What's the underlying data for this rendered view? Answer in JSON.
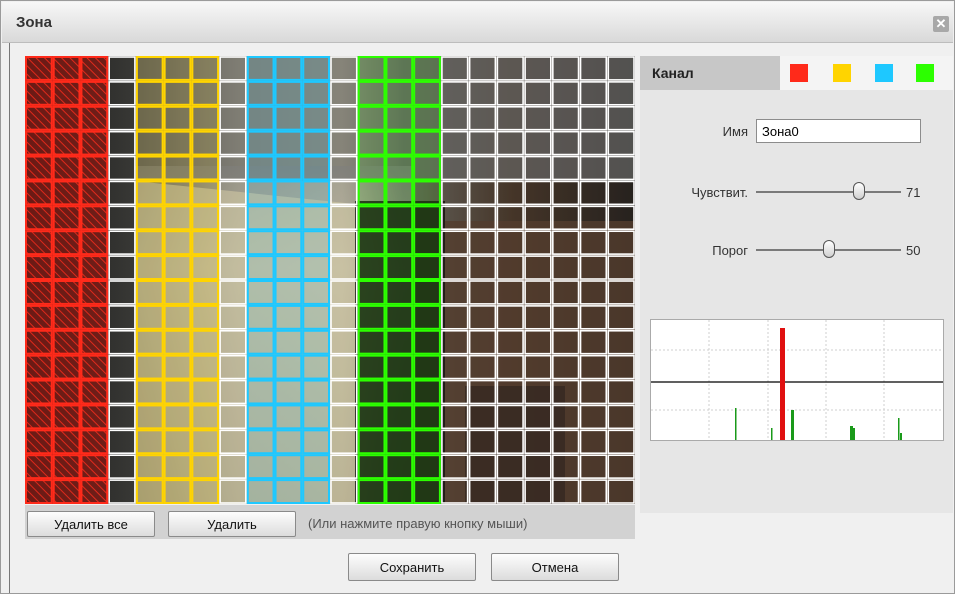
{
  "window": {
    "title": "Зона",
    "close_glyph": "✕"
  },
  "grid": {
    "cols": 22,
    "rows": 18,
    "zones": [
      {
        "color": "#ff2a1a",
        "col_start": 0,
        "col_end": 2,
        "style": "hatched"
      },
      {
        "color": "#ffd400",
        "col_start": 4,
        "col_end": 6,
        "style": "outlined"
      },
      {
        "color": "#1ec8ff",
        "col_start": 8,
        "col_end": 10,
        "style": "outlined"
      },
      {
        "color": "#2cff00",
        "col_start": 12,
        "col_end": 14,
        "style": "outlined"
      }
    ]
  },
  "buttons": {
    "delete_all": "Удалить все",
    "delete": "Удалить",
    "hint": "(Или нажмите правую кнопку мыши)",
    "save": "Сохранить",
    "cancel": "Отмена"
  },
  "panel": {
    "channel_label": "Канал",
    "swatches": [
      {
        "name": "red-zone-swatch",
        "color": "#ff2a1a"
      },
      {
        "name": "yellow-zone-swatch",
        "color": "#ffd400"
      },
      {
        "name": "cyan-zone-swatch",
        "color": "#1ec8ff"
      },
      {
        "name": "green-zone-swatch",
        "color": "#2cff00"
      }
    ],
    "name_label": "Имя",
    "name_value": "Зона0",
    "sensitivity_label": "Чувствит.",
    "sensitivity_value": "71",
    "sensitivity_level": 0.71,
    "threshold_label": "Порог",
    "threshold_value": "50",
    "threshold_level": 0.5
  }
}
